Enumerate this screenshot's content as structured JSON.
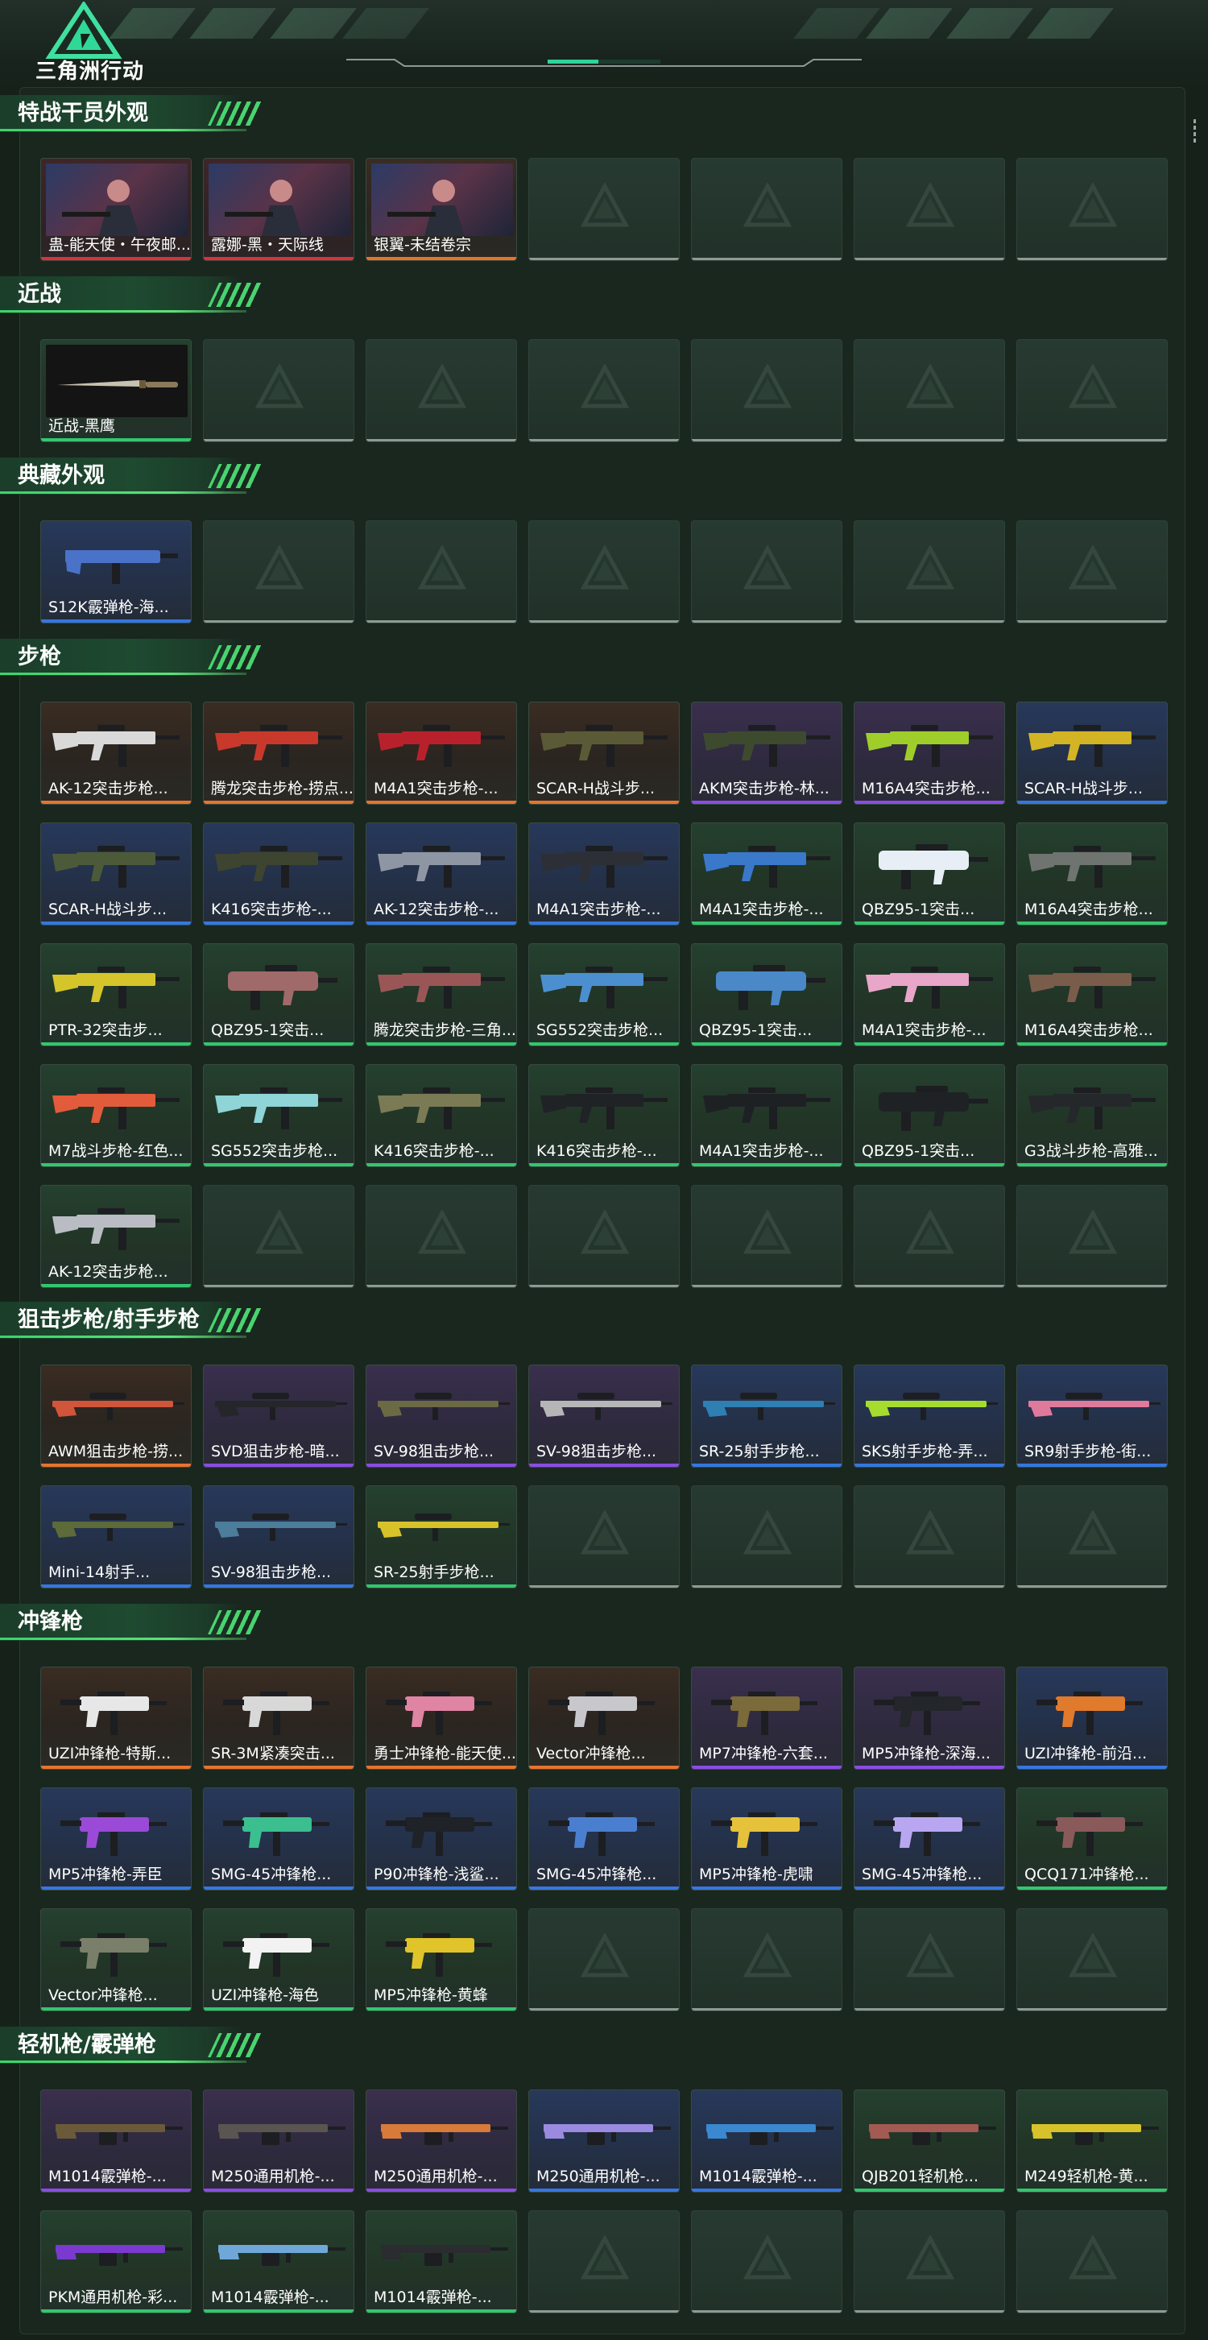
{
  "app": {
    "logo_text": "三角洲行动",
    "header_progress": 0.45,
    "accent_color": "#2fd39a"
  },
  "sections": [
    {
      "title": "特战干员外观",
      "items": [
        {
          "name": "蛊-能天使・午夜邮...",
          "quality": "red",
          "kind": "agent"
        },
        {
          "name": "露娜-黑・天际线",
          "quality": "red",
          "kind": "agent"
        },
        {
          "name": "银翼-未结卷宗",
          "quality": "orange",
          "kind": "agent"
        },
        {
          "empty": true
        },
        {
          "empty": true
        },
        {
          "empty": true
        },
        {
          "empty": true
        }
      ]
    },
    {
      "title": "近战",
      "items": [
        {
          "name": "近战-黑鹰",
          "quality": "green",
          "kind": "melee"
        },
        {
          "empty": true
        },
        {
          "empty": true
        },
        {
          "empty": true
        },
        {
          "empty": true
        },
        {
          "empty": true
        },
        {
          "empty": true
        }
      ]
    },
    {
      "title": "典藏外观",
      "items": [
        {
          "name": "S12K霰弹枪-海...",
          "quality": "blue",
          "kind": "shotgun",
          "color": "#4a72c8"
        },
        {
          "empty": true
        },
        {
          "empty": true
        },
        {
          "empty": true
        },
        {
          "empty": true
        },
        {
          "empty": true
        },
        {
          "empty": true
        }
      ]
    },
    {
      "title": "步枪",
      "items": [
        {
          "name": "AK-12突击步枪...",
          "quality": "orange",
          "kind": "rifle",
          "color": "#d9d9d9"
        },
        {
          "name": "腾龙突击步枪-捞点...",
          "quality": "orange",
          "kind": "rifle",
          "color": "#c8392b"
        },
        {
          "name": "M4A1突击步枪-...",
          "quality": "orange",
          "kind": "rifle",
          "color": "#b8212c"
        },
        {
          "name": "SCAR-H战斗步...",
          "quality": "orange",
          "kind": "rifle",
          "color": "#5b5a36"
        },
        {
          "name": "AKM突击步枪-林...",
          "quality": "purple",
          "kind": "rifle",
          "color": "#3e4a2e"
        },
        {
          "name": "M16A4突击步枪...",
          "quality": "purple",
          "kind": "rifle",
          "color": "#9fce2a"
        },
        {
          "name": "SCAR-H战斗步...",
          "quality": "blue",
          "kind": "rifle",
          "color": "#d2b425"
        },
        {
          "name": "SCAR-H战斗步...",
          "quality": "blue",
          "kind": "rifle",
          "color": "#4c5a3a"
        },
        {
          "name": "K416突击步枪-...",
          "quality": "blue",
          "kind": "rifle",
          "color": "#3d4530"
        },
        {
          "name": "AK-12突击步枪-...",
          "quality": "blue",
          "kind": "rifle",
          "color": "#8f96a3"
        },
        {
          "name": "M4A1突击步枪-...",
          "quality": "blue",
          "kind": "rifle",
          "color": "#2c2f36"
        },
        {
          "name": "M4A1突击步枪-...",
          "quality": "green",
          "kind": "rifle",
          "color": "#3a78c9"
        },
        {
          "name": "QBZ95-1突击...",
          "quality": "green",
          "kind": "bullpup",
          "color": "#e8eef5"
        },
        {
          "name": "M16A4突击步枪...",
          "quality": "green",
          "kind": "rifle",
          "color": "#6f7470"
        },
        {
          "name": "PTR-32突击步...",
          "quality": "green",
          "kind": "rifle",
          "color": "#d6c52a"
        },
        {
          "name": "QBZ95-1突击...",
          "quality": "green",
          "kind": "bullpup",
          "color": "#a06a6a"
        },
        {
          "name": "腾龙突击步枪-三角...",
          "quality": "green",
          "kind": "rifle",
          "color": "#9a5656"
        },
        {
          "name": "SG552突击步枪...",
          "quality": "green",
          "kind": "rifle",
          "color": "#4b8fd1"
        },
        {
          "name": "QBZ95-1突击...",
          "quality": "green",
          "kind": "bullpup",
          "color": "#4a88c8"
        },
        {
          "name": "M4A1突击步枪-...",
          "quality": "green",
          "kind": "rifle",
          "color": "#e8a6c9"
        },
        {
          "name": "M16A4突击步枪...",
          "quality": "green",
          "kind": "rifle",
          "color": "#7a5c4a"
        },
        {
          "name": "M7战斗步枪-红色...",
          "quality": "green",
          "kind": "rifle",
          "color": "#e25b3a"
        },
        {
          "name": "SG552突击步枪...",
          "quality": "green",
          "kind": "rifle",
          "color": "#8fd4d6"
        },
        {
          "name": "K416突击步枪-...",
          "quality": "green",
          "kind": "rifle",
          "color": "#7a7a55"
        },
        {
          "name": "K416突击步枪-...",
          "quality": "green",
          "kind": "rifle",
          "color": "#202326"
        },
        {
          "name": "M4A1突击步枪-...",
          "quality": "green",
          "kind": "rifle",
          "color": "#1e2124"
        },
        {
          "name": "QBZ95-1突击...",
          "quality": "green",
          "kind": "bullpup",
          "color": "#1f2225"
        },
        {
          "name": "G3战斗步枪-高雅...",
          "quality": "green",
          "kind": "rifle",
          "color": "#25282b"
        },
        {
          "name": "AK-12突击步枪...",
          "quality": "green",
          "kind": "rifle",
          "color": "#b9bdc3"
        },
        {
          "empty": true
        },
        {
          "empty": true
        },
        {
          "empty": true
        },
        {
          "empty": true
        },
        {
          "empty": true
        },
        {
          "empty": true
        }
      ]
    },
    {
      "title": "狙击步枪/射手步枪",
      "items": [
        {
          "name": "AWM狙击步枪-捞...",
          "quality": "orange",
          "kind": "sniper",
          "color": "#d0553a"
        },
        {
          "name": "SVD狙击步枪-暗...",
          "quality": "purple",
          "kind": "sniper",
          "color": "#25262a"
        },
        {
          "name": "SV-98狙击步枪...",
          "quality": "purple",
          "kind": "sniper",
          "color": "#6b6a45"
        },
        {
          "name": "SV-98狙击步枪...",
          "quality": "purple",
          "kind": "sniper",
          "color": "#b6b6b6"
        },
        {
          "name": "SR-25射手步枪...",
          "quality": "blue",
          "kind": "sniper",
          "color": "#2f7fb3"
        },
        {
          "name": "SKS射手步枪-弄...",
          "quality": "blue",
          "kind": "sniper",
          "color": "#a6dc2e"
        },
        {
          "name": "SR9射手步枪-街...",
          "quality": "blue",
          "kind": "sniper",
          "color": "#e07a9c"
        },
        {
          "name": "Mini-14射手...",
          "quality": "blue",
          "kind": "sniper",
          "color": "#5d6a3a"
        },
        {
          "name": "SV-98狙击步枪...",
          "quality": "blue",
          "kind": "sniper",
          "color": "#4c7d9a"
        },
        {
          "name": "SR-25射手步枪...",
          "quality": "green",
          "kind": "sniper",
          "color": "#d8c22a"
        },
        {
          "empty": true
        },
        {
          "empty": true
        },
        {
          "empty": true
        },
        {
          "empty": true
        }
      ]
    },
    {
      "title": "冲锋枪",
      "items": [
        {
          "name": "UZI冲锋枪-特斯...",
          "quality": "orange",
          "kind": "smg",
          "color": "#e7e7e7"
        },
        {
          "name": "SR-3M紧凑突击...",
          "quality": "orange",
          "kind": "smg",
          "color": "#d8d8d8"
        },
        {
          "name": "勇士冲锋枪-能天使...",
          "quality": "orange",
          "kind": "smg",
          "color": "#e084a4"
        },
        {
          "name": "Vector冲锋枪...",
          "quality": "orange",
          "kind": "smg",
          "color": "#c8c8cc"
        },
        {
          "name": "MP7冲锋枪-六套...",
          "quality": "purple",
          "kind": "smg",
          "color": "#7b6a3a"
        },
        {
          "name": "MP5冲锋枪-深海...",
          "quality": "purple",
          "kind": "smg",
          "color": "#23262b"
        },
        {
          "name": "UZI冲锋枪-前沿...",
          "quality": "blue",
          "kind": "smg",
          "color": "#e07a2c"
        },
        {
          "name": "MP5冲锋枪-弄臣",
          "quality": "blue",
          "kind": "smg",
          "color": "#9a4ad6"
        },
        {
          "name": "SMG-45冲锋枪...",
          "quality": "blue",
          "kind": "smg",
          "color": "#3bbf8e"
        },
        {
          "name": "P90冲锋枪-浅鲨...",
          "quality": "blue",
          "kind": "smg",
          "color": "#1f2227"
        },
        {
          "name": "SMG-45冲锋枪...",
          "quality": "blue",
          "kind": "smg",
          "color": "#4a7fd0"
        },
        {
          "name": "MP5冲锋枪-虎啸",
          "quality": "blue",
          "kind": "smg",
          "color": "#e6c23a"
        },
        {
          "name": "SMG-45冲锋枪...",
          "quality": "blue",
          "kind": "smg",
          "color": "#b9a6f0"
        },
        {
          "name": "QCQ171冲锋枪...",
          "quality": "green",
          "kind": "smg",
          "color": "#8a5a5a"
        },
        {
          "name": "Vector冲锋枪...",
          "quality": "green",
          "kind": "smg",
          "color": "#7a7f6a"
        },
        {
          "name": "UZI冲锋枪-海色",
          "quality": "green",
          "kind": "smg",
          "color": "#f2f2f2"
        },
        {
          "name": "MP5冲锋枪-黄蜂",
          "quality": "green",
          "kind": "smg",
          "color": "#e0c42a"
        },
        {
          "empty": true
        },
        {
          "empty": true
        },
        {
          "empty": true
        },
        {
          "empty": true
        }
      ]
    },
    {
      "title": "轻机枪/霰弹枪",
      "items": [
        {
          "name": "M1014霰弹枪-...",
          "quality": "purple",
          "kind": "lmg",
          "color": "#6a5a3a"
        },
        {
          "name": "M250通用机枪-...",
          "quality": "purple",
          "kind": "lmg",
          "color": "#5a5550"
        },
        {
          "name": "M250通用机枪-...",
          "quality": "purple",
          "kind": "lmg",
          "color": "#d87a3a"
        },
        {
          "name": "M250通用机枪-...",
          "quality": "blue",
          "kind": "lmg",
          "color": "#9a8ae0"
        },
        {
          "name": "M1014霰弹枪-...",
          "quality": "blue",
          "kind": "lmg",
          "color": "#3a88d0"
        },
        {
          "name": "QJB201轻机枪...",
          "quality": "green",
          "kind": "lmg",
          "color": "#a25a52"
        },
        {
          "name": "M249轻机枪-黄...",
          "quality": "green",
          "kind": "lmg",
          "color": "#d8c22a"
        },
        {
          "name": "PKM通用机枪-彩...",
          "quality": "green",
          "kind": "lmg",
          "color": "#7a3ad0"
        },
        {
          "name": "M1014霰弹枪-...",
          "quality": "green",
          "kind": "lmg",
          "color": "#6fa8d8"
        },
        {
          "name": "M1014霰弹枪-...",
          "quality": "green",
          "kind": "lmg",
          "color": "#2a2c30"
        },
        {
          "empty": true
        },
        {
          "empty": true
        },
        {
          "empty": true
        },
        {
          "empty": true
        }
      ]
    }
  ]
}
